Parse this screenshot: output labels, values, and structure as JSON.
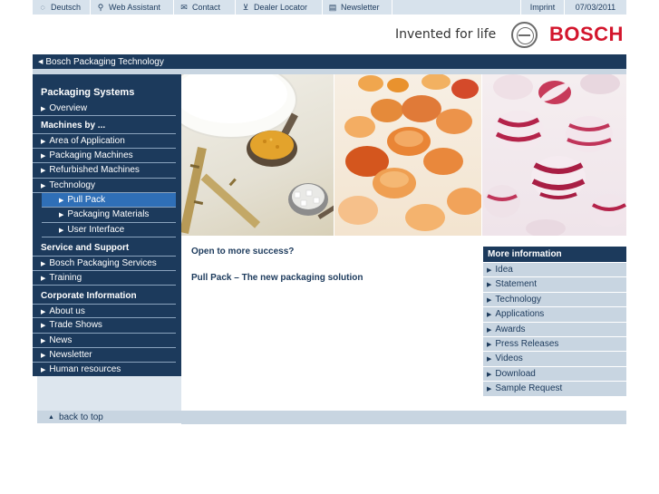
{
  "topbar": {
    "deutsch": "Deutsch",
    "web_assistant": "Web Assistant",
    "contact": "Contact",
    "dealer_locator": "Dealer Locator",
    "newsletter": "Newsletter",
    "imprint": "Imprint",
    "date": "07/03/2011"
  },
  "header": {
    "tagline": "Invented for life",
    "brand": "BOSCH"
  },
  "breadcrumb": {
    "label": "Bosch Packaging Technology"
  },
  "sidebar": {
    "title": "Packaging Systems",
    "overview": "Overview",
    "machines_by": "Machines by ...",
    "area_of_application": "Area of Application",
    "packaging_machines": "Packaging Machines",
    "refurbished_machines": "Refurbished Machines",
    "technology": "Technology",
    "pull_pack": "Pull Pack",
    "packaging_materials": "Packaging Materials",
    "user_interface": "User Interface",
    "service_and_support": "Service and Support",
    "bosch_packaging_services": "Bosch Packaging Services",
    "training": "Training",
    "corporate_information": "Corporate Information",
    "about_us": "About us",
    "trade_shows": "Trade Shows",
    "news": "News",
    "newsletter": "Newsletter",
    "human_resources": "Human resources"
  },
  "footer": {
    "back_to_top": "back to top"
  },
  "content": {
    "headline": "Open to more success?",
    "subline": "Pull Pack – The new packaging solution"
  },
  "info": {
    "title": "More information",
    "items": [
      "Idea",
      "Statement",
      "Technology",
      "Applications",
      "Awards",
      "Press Releases",
      "Videos",
      "Download",
      "Sample Request"
    ]
  },
  "colors": {
    "navy": "#1c3a5c",
    "active_blue": "#2f6fb7",
    "light_blue": "#c8d5e1",
    "brand_red": "#d3152c"
  }
}
